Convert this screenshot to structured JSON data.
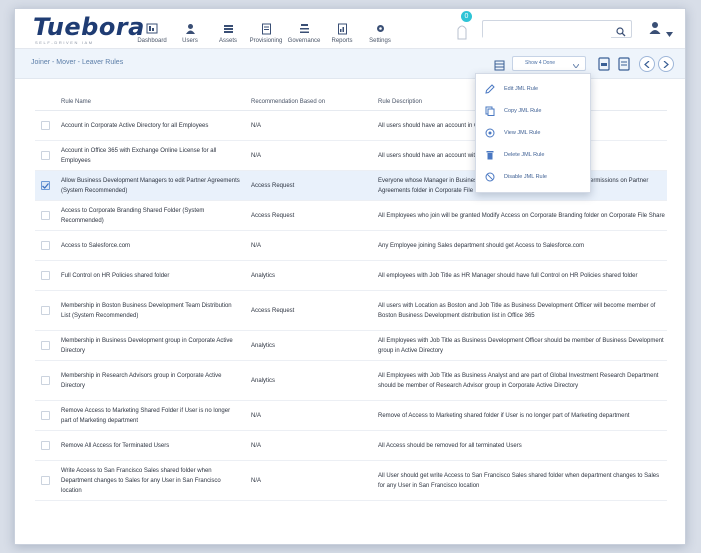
{
  "app": {
    "logo": "Tuebora",
    "tagline": "SELF-DRIVEN IAM"
  },
  "nav": [
    {
      "label": "Dashboard",
      "icon": "dashboard-icon"
    },
    {
      "label": "Users",
      "icon": "users-icon"
    },
    {
      "label": "Assets",
      "icon": "assets-icon"
    },
    {
      "label": "Provisioning",
      "icon": "provisioning-icon"
    },
    {
      "label": "Governance",
      "icon": "governance-icon"
    },
    {
      "label": "Reports",
      "icon": "reports-icon"
    },
    {
      "label": "Settings",
      "icon": "settings-icon"
    }
  ],
  "header": {
    "alert_count": "0",
    "search_placeholder": "",
    "search_icon": "search-icon",
    "user_icon": "user-icon"
  },
  "toolbar": {
    "breadcrumb": "Joiner - Mover - Leaver Rules",
    "select_value": "Show 4 Done"
  },
  "colors": {
    "brand": "#1f3c73",
    "accent": "#2ec4d6",
    "toolbar_bg": "#eef4fb",
    "selected_row": "#e9f1fb"
  },
  "menu": [
    {
      "label": "Edit JML Rule",
      "icon": "pencil-icon"
    },
    {
      "label": "Copy JML Rule",
      "icon": "copy-icon"
    },
    {
      "label": "View JML Rule",
      "icon": "eye-icon"
    },
    {
      "label": "Delete JML Rule",
      "icon": "trash-icon"
    },
    {
      "label": "Disable JML Rule",
      "icon": "disable-icon"
    }
  ],
  "table": {
    "columns": [
      "Rule Name",
      "Recommendation Based on",
      "Rule Description"
    ],
    "rows": [
      {
        "name": "Account in Corporate Active Directory for all Employees",
        "rec": "N/A",
        "desc": "All users should have an account in Corporate Active Directory",
        "selected": false
      },
      {
        "name": "Account in Office 365 with Exchange Online License for all Employees",
        "rec": "N/A",
        "desc": "All users should have an account with Exchange Online license",
        "selected": false
      },
      {
        "name": "Allow Business Development Managers to edit Partner Agreements (System Recommended)",
        "rec": "Access Request",
        "desc": "Everyone whose Manager in Business Development will have Read and Write permissions on Partner Agreements folder in Corporate File Share",
        "selected": true
      },
      {
        "name": "Access to Corporate Branding Shared Folder (System Recommended)",
        "rec": "Access Request",
        "desc": "All Employees who join will be granted Modify Access on Corporate Branding folder on Corporate File Share",
        "selected": false
      },
      {
        "name": "Access to Salesforce.com",
        "rec": "N/A",
        "desc": "Any Employee joining Sales department should get Access to Salesforce.com",
        "selected": false
      },
      {
        "name": "Full Control on HR Policies shared folder",
        "rec": "Analytics",
        "desc": "All employees with Job Title as HR Manager should have full Control on HR Policies shared folder",
        "selected": false
      },
      {
        "name": "Membership in Boston Business Development Team Distribution List (System Recommended)",
        "rec": "Access Request",
        "desc": "All users with Location as Boston and Job Title as Business Development Officer will become member of Boston Business Development distribution list in Office 365",
        "selected": false
      },
      {
        "name": "Membership in Business Development group in Corporate Active Directory",
        "rec": "Analytics",
        "desc": "All Employees with Job Title as Business Development Officer should be member of Business Development group in Active Directory",
        "selected": false
      },
      {
        "name": "Membership in Research Advisors group in Corporate Active Directory",
        "rec": "Analytics",
        "desc": "All Employees with Job Title as Business Analyst and are part of Global Investment Research Department should be member of Research Advisor group in Corporate Active Directory",
        "selected": false
      },
      {
        "name": "Remove Access to Marketing Shared Folder if User is no longer part of Marketing department",
        "rec": "N/A",
        "desc": "Remove of Access to Marketing shared folder if User is no longer part of Marketing department",
        "selected": false
      },
      {
        "name": "Remove All Access for Terminated Users",
        "rec": "N/A",
        "desc": "All Access should be removed for all terminated Users",
        "selected": false
      },
      {
        "name": "Write Access to San Francisco Sales shared folder when Department changes to Sales for any User in San Francisco location",
        "rec": "N/A",
        "desc": "All User should get write Access to San Francisco Sales shared folder when department changes to Sales for any User in San Francisco location",
        "selected": false
      }
    ]
  }
}
